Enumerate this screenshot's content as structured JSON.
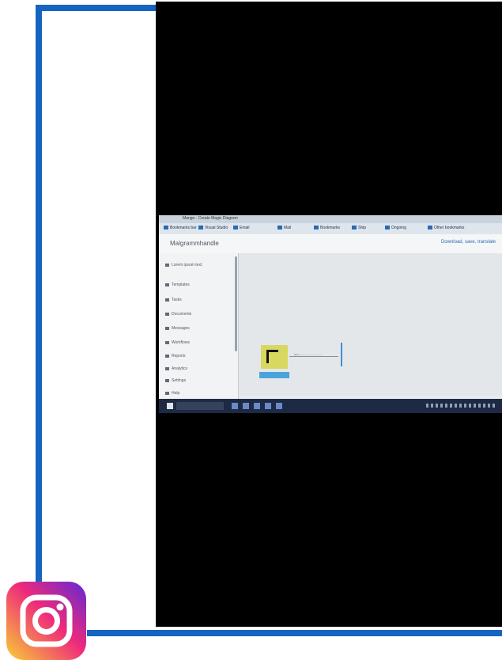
{
  "browser": {
    "tab_title": "Mango - Create Magic Diagram",
    "bookmarks": [
      {
        "label": "Bookmarks bar"
      },
      {
        "label": "Visual Studio"
      },
      {
        "label": "Email"
      },
      {
        "label": "Mail"
      },
      {
        "label": "Bookmarks"
      },
      {
        "label": "Ship"
      },
      {
        "label": "Ongoing"
      },
      {
        "label": "Other bookmarks"
      }
    ]
  },
  "site": {
    "name": "Malgrammhandle",
    "action_label": "Download, save, translate"
  },
  "sidebar": {
    "items": [
      {
        "label": "Lorem ipsum text"
      },
      {
        "label": "Templates"
      },
      {
        "label": "Tasks"
      },
      {
        "label": "Documents"
      },
      {
        "label": "Messages"
      },
      {
        "label": "Workflows"
      },
      {
        "label": "Reports"
      },
      {
        "label": "Analytics"
      },
      {
        "label": "Settings"
      },
      {
        "label": "Help"
      }
    ]
  },
  "diagram": {
    "connector_label": "label ----------------------------"
  },
  "colors": {
    "frame": "#1565c0",
    "taskbar": "#1e2a44",
    "diagram_box": "#d8d860",
    "diagram_bar": "#4aa3d9"
  },
  "icons": {
    "instagram": "instagram-logo"
  }
}
